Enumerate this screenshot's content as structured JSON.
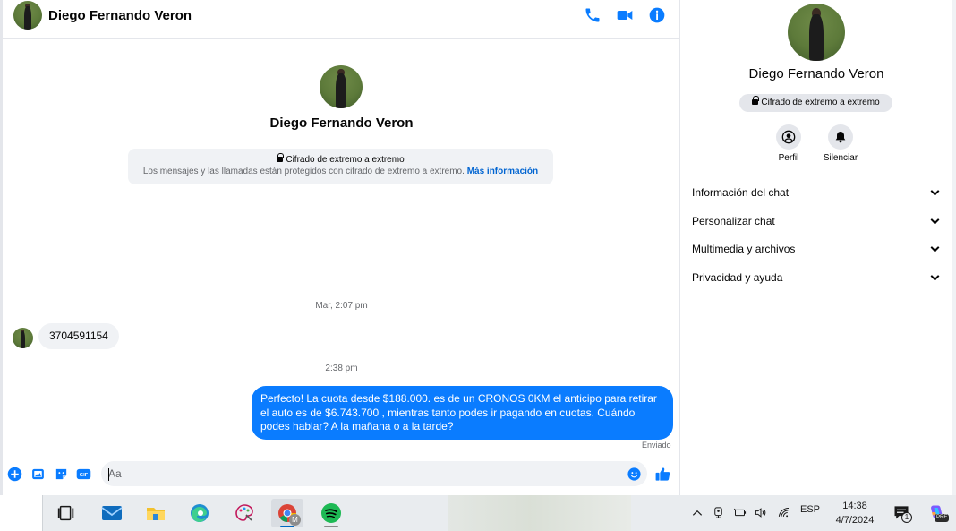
{
  "header": {
    "contact_name": "Diego Fernando Veron",
    "icons": [
      "phone-icon",
      "video-camera-icon",
      "info-icon"
    ]
  },
  "intro": {
    "name": "Diego Fernando Veron",
    "e2e_title": "Cifrado de extremo a extremo",
    "e2e_description": "Los mensajes y las llamadas están protegidos con cifrado de extremo a extremo.",
    "e2e_link": "Más información"
  },
  "messages": [
    {
      "timestamp": "Mar, 2:07 pm",
      "direction": "incoming",
      "text": "3704591154"
    },
    {
      "timestamp": "2:38 pm",
      "direction": "outgoing",
      "text": "Perfecto! La cuota desde $188.000. es de un CRONOS 0KM el anticipo para retirar el auto es de $6.743.700 , mientras tanto podes ir pagando en cuotas. Cuándo podes hablar? A la mañana o a la tarde?",
      "status": "Enviado"
    }
  ],
  "composer": {
    "placeholder": "Aa",
    "icons": [
      "plus-icon",
      "photo-icon",
      "sticker-icon",
      "gif-icon",
      "emoji-icon",
      "thumbs-up-icon"
    ],
    "gif_label": "GIF"
  },
  "sidebar": {
    "name": "Diego Fernando Veron",
    "badge": "Cifrado de extremo a extremo",
    "actions": [
      {
        "label": "Perfil",
        "icon": "profile-icon"
      },
      {
        "label": "Silenciar",
        "icon": "bell-icon"
      }
    ],
    "sections": [
      {
        "label": "Información del chat"
      },
      {
        "label": "Personalizar chat"
      },
      {
        "label": "Multimedia y archivos"
      },
      {
        "label": "Privacidad y ayuda"
      }
    ]
  },
  "taskbar": {
    "apps": [
      "task-view-icon",
      "mail-icon",
      "file-explorer-icon",
      "edge-icon",
      "paint-icon",
      "chrome-icon",
      "spotify-icon"
    ],
    "chrome_badge": "M",
    "language": "ESP",
    "time": "14:38",
    "date": "4/7/2024",
    "notification_count": "1",
    "copilot_badge": "PRE"
  },
  "colors": {
    "accent": "#0a7cff",
    "link": "#0064d1",
    "bubble_incoming": "#f0f2f5",
    "text_secondary": "#65676b"
  }
}
